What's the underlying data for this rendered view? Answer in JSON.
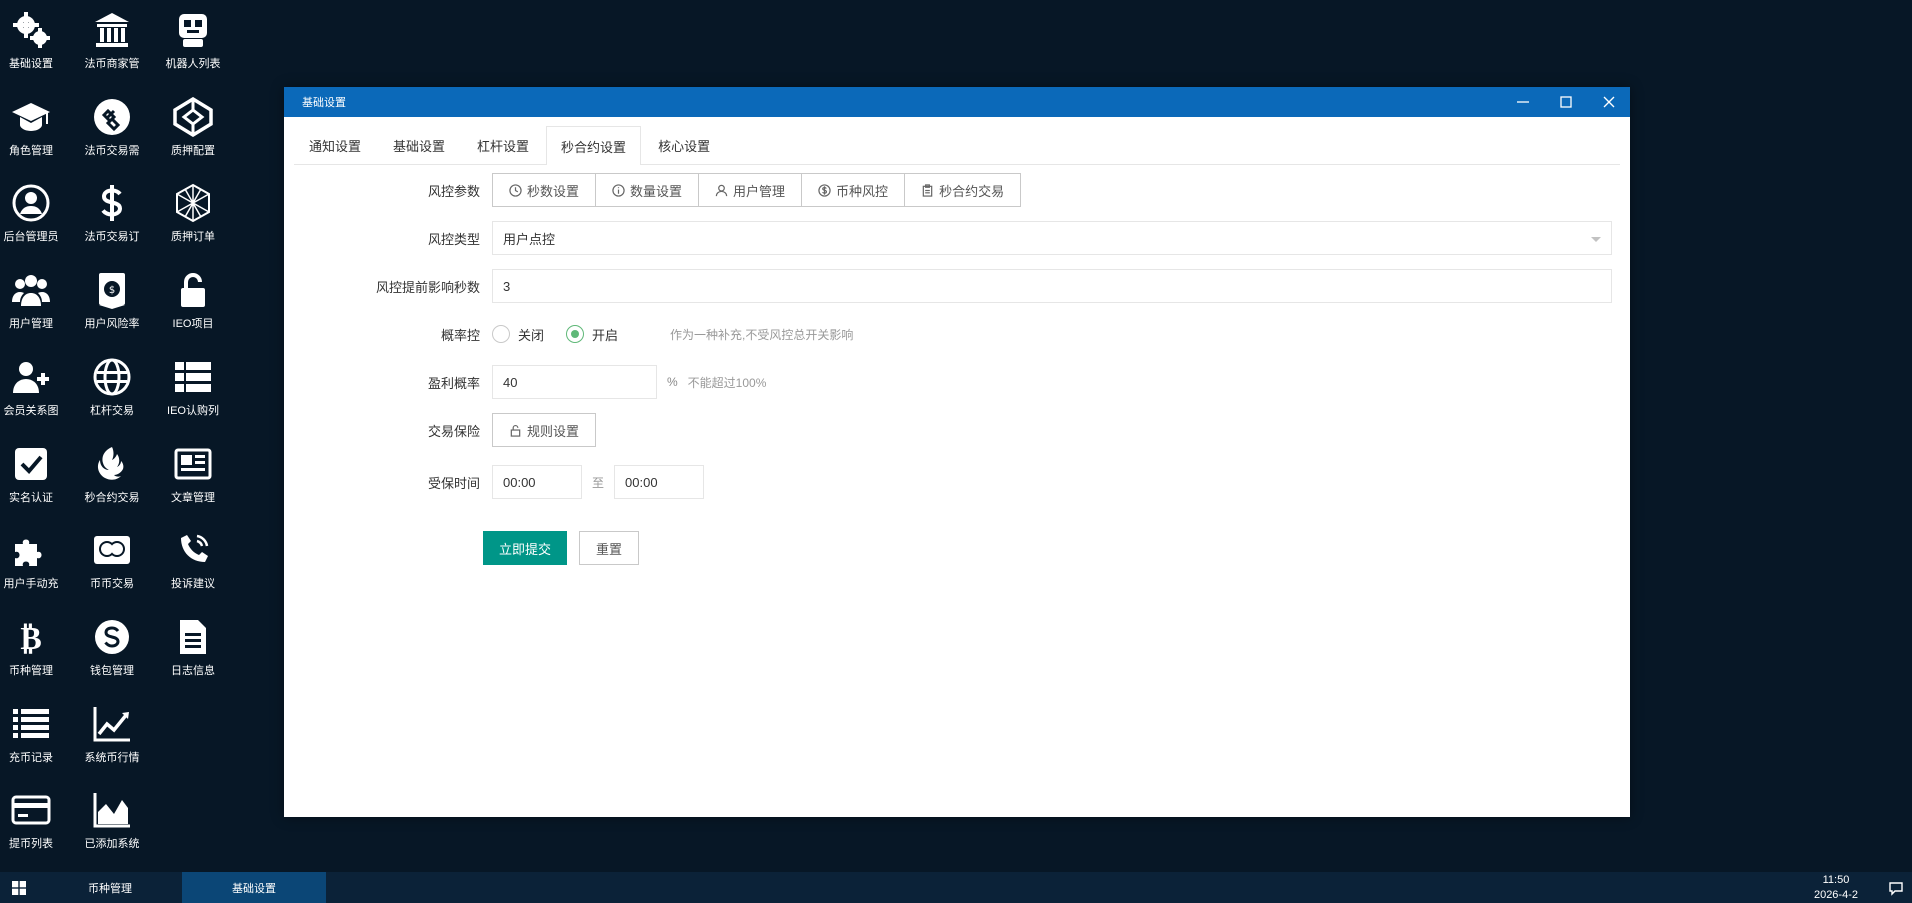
{
  "desktop": {
    "col1": [
      {
        "label": "基础设置",
        "icon": "gears-icon"
      },
      {
        "label": "角色管理",
        "icon": "graduation-cap-icon"
      },
      {
        "label": "后台管理员",
        "icon": "user-circle-icon"
      },
      {
        "label": "用户管理",
        "icon": "users-icon"
      },
      {
        "label": "会员关系图",
        "icon": "user-plus-icon"
      },
      {
        "label": "实名认证",
        "icon": "check-square-icon"
      },
      {
        "label": "用户手动充",
        "icon": "puzzle-icon"
      },
      {
        "label": "币种管理",
        "icon": "bitcoin-icon"
      },
      {
        "label": "充币记录",
        "icon": "list-icon"
      },
      {
        "label": "提币列表",
        "icon": "credit-card-icon"
      }
    ],
    "col2": [
      {
        "label": "法币商家管",
        "icon": "bank-icon"
      },
      {
        "label": "法币交易需",
        "icon": "link-circle-icon"
      },
      {
        "label": "法币交易订",
        "icon": "dollar-icon"
      },
      {
        "label": "用户风险率",
        "icon": "shield-badge-icon"
      },
      {
        "label": "杠杆交易",
        "icon": "globe-stripes-icon"
      },
      {
        "label": "秒合约交易",
        "icon": "rebel-icon"
      },
      {
        "label": "币币交易",
        "icon": "mastercard-icon"
      },
      {
        "label": "钱包管理",
        "icon": "skype-icon"
      },
      {
        "label": "系统币行情",
        "icon": "line-chart-icon"
      },
      {
        "label": "已添加系统",
        "icon": "area-chart-icon"
      }
    ],
    "col3": [
      {
        "label": "机器人列表",
        "icon": "robot-icon"
      },
      {
        "label": "质押配置",
        "icon": "codepen-icon"
      },
      {
        "label": "质押订单",
        "icon": "polyhedron-icon"
      },
      {
        "label": "IEO项目",
        "icon": "unlock-icon"
      },
      {
        "label": "IEO认购列",
        "icon": "th-list-icon"
      },
      {
        "label": "文章管理",
        "icon": "newspaper-icon"
      },
      {
        "label": "投诉建议",
        "icon": "phone-volume-icon"
      },
      {
        "label": "日志信息",
        "icon": "file-text-icon"
      }
    ]
  },
  "window": {
    "title": "基础设置",
    "tabs": [
      {
        "label": "通知设置",
        "active": false
      },
      {
        "label": "基础设置",
        "active": false
      },
      {
        "label": "杠杆设置",
        "active": false
      },
      {
        "label": "秒合约设置",
        "active": true
      },
      {
        "label": "核心设置",
        "active": false
      }
    ]
  },
  "form": {
    "risk_params": {
      "label": "风控参数",
      "buttons": [
        {
          "label": "秒数设置",
          "icon": "clock-icon"
        },
        {
          "label": "数量设置",
          "icon": "info-icon"
        },
        {
          "label": "用户管理",
          "icon": "user-icon"
        },
        {
          "label": "币种风控",
          "icon": "dollar-circle-icon"
        },
        {
          "label": "秒合约交易",
          "icon": "clipboard-icon"
        }
      ]
    },
    "risk_type": {
      "label": "风控类型",
      "value": "用户点控"
    },
    "advance_seconds": {
      "label": "风控提前影响秒数",
      "value": "3"
    },
    "probability_control": {
      "label": "概率控",
      "options": [
        {
          "label": "关闭",
          "checked": false
        },
        {
          "label": "开启",
          "checked": true
        }
      ],
      "hint": "作为一种补充,不受风控总开关影响"
    },
    "profit_probability": {
      "label": "盈利概率",
      "value": "40",
      "unit": "%",
      "hint": "不能超过100%"
    },
    "trade_insurance": {
      "label": "交易保险",
      "button": "规则设置"
    },
    "protected_time": {
      "label": "受保时间",
      "start": "00:00",
      "separator": "至",
      "end": "00:00"
    },
    "submit": "立即提交",
    "reset": "重置"
  },
  "taskbar": {
    "items": [
      {
        "label": "币种管理",
        "active": false
      },
      {
        "label": "基础设置",
        "active": true
      }
    ],
    "time": "11:50",
    "date": "2026-4-2"
  },
  "colors": {
    "desktop_bg": "#071726",
    "titlebar": "#0b69b9",
    "submit": "#009688",
    "radio_checked": "#5fb878",
    "taskbar": "#0b2238",
    "taskbar_active": "#0b4676"
  }
}
